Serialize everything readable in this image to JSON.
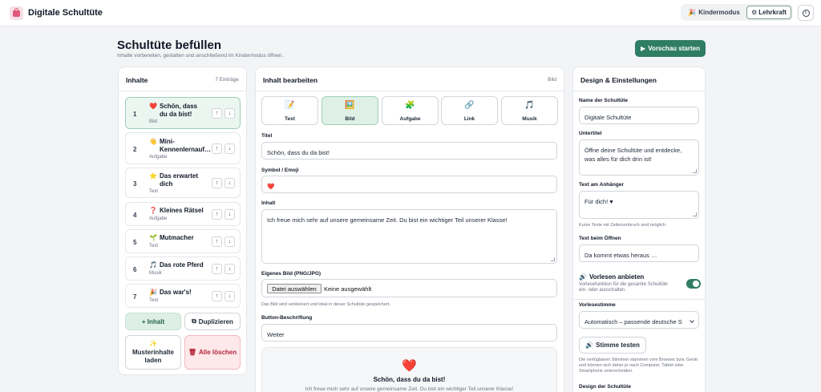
{
  "app": {
    "title": "Digitale Schultüte"
  },
  "header": {
    "kids_mode": "Kindermodus",
    "kids_icon": "🎉",
    "teacher_mode": "Lehrkraft",
    "teacher_icon": "⚙",
    "info_icon": "i"
  },
  "page": {
    "title": "Schultüte befüllen",
    "subtitle": "Inhalte vorbereiten, gestalten und anschließend im Kindermodus öffnen.",
    "preview_button": "Vorschau starten",
    "preview_icon": "▶"
  },
  "contents": {
    "title": "Inhalte",
    "count": "7 Einträge",
    "items": [
      {
        "num": "1",
        "emoji": "❤️",
        "title": "Schön, dass du da bist!",
        "type": "Bild"
      },
      {
        "num": "2",
        "emoji": "👋",
        "title": "Mini-Kennenlernauf…",
        "type": "Aufgabe"
      },
      {
        "num": "3",
        "emoji": "⭐",
        "title": "Das erwartet dich",
        "type": "Text"
      },
      {
        "num": "4",
        "emoji": "❓",
        "title": "Kleines Rätsel",
        "type": "Aufgabe"
      },
      {
        "num": "5",
        "emoji": "🌱",
        "title": "Mutmacher",
        "type": "Text"
      },
      {
        "num": "6",
        "emoji": "🎵",
        "title": "Das rote Pferd",
        "type": "Musik"
      },
      {
        "num": "7",
        "emoji": "🎉",
        "title": "Das war's!",
        "type": "Text"
      }
    ],
    "arrow_up": "↑",
    "arrow_down": "↓",
    "add_button": "+ Inhalt",
    "duplicate_button": "Duplizieren",
    "duplicate_icon": "⧉",
    "sample_button": "Musterinhalte laden",
    "sample_icon": "✨",
    "delete_button": "Alle löschen",
    "delete_icon": "🗑"
  },
  "editor": {
    "title": "Inhalt bearbeiten",
    "meta": "Bild",
    "types": [
      {
        "icon": "📝",
        "label": "Text"
      },
      {
        "icon": "🖼️",
        "label": "Bild"
      },
      {
        "icon": "🧩",
        "label": "Aufgabe"
      },
      {
        "icon": "🔗",
        "label": "Link"
      },
      {
        "icon": "🎵",
        "label": "Musik"
      }
    ],
    "title_label": "Titel",
    "title_value": "Schön, dass du da bist!",
    "symbol_label": "Symbol / Emoji",
    "symbol_value": "❤️",
    "content_label": "Inhalt",
    "content_value": "Ich freue mich sehr auf unsere gemeinsame Zeit. Du bist ein wichtiger Teil unserer Klasse!",
    "image_label": "Eigenes Bild (PNG/JPG)",
    "file_button": "Datei auswählen",
    "file_status": "Keine ausgewählt",
    "image_hint": "Das Bild wird verkleinert und lokal in dieser Schultüte gespeichert.",
    "button_label": "Button-Beschriftung",
    "button_value": "Weiter",
    "preview": {
      "emoji": "❤️",
      "title": "Schön, dass du da bist!",
      "text": "Ich freue mich sehr auf unsere gemeinsame Zeit. Du bist ein wichtiger Teil unserer Klasse!"
    }
  },
  "design": {
    "title": "Design & Einstellungen",
    "name_label": "Name der Schultüte",
    "name_value": "Digitale Schultüte",
    "subtitle_label": "Untertitel",
    "subtitle_value": "Öffne deine Schultüte und entdecke, was alles für dich drin ist!",
    "tag_label": "Text am Anhänger",
    "tag_value": "Für dich! ♥",
    "tag_hint": "Kurze Texte mit Zeilenumbruch sind möglich.",
    "open_label": "Text beim Öffnen",
    "open_value": "Da kommt etwas heraus …",
    "read_title": "Vorlesen anbieten",
    "read_icon": "🔊",
    "read_desc": "Vorlesefunktion für die gesamte Schultüte ein- oder ausschalten.",
    "read_enabled": true,
    "voice_label": "Vorlesestimme",
    "voice_value": "Automatisch – passende deutsche S",
    "test_button": "Stimme testen",
    "test_icon": "🔊",
    "voice_hint": "Die verfügbaren Stimmen stammen vom Browser bzw. Gerät und können sich daher je nach Computer, Tablet oder Smartphone unterscheiden.",
    "design_label": "Design der Schultüte"
  },
  "colors": {
    "accent": "#2f7d64",
    "accent_light": "#ddefe6",
    "danger": "#b4233a"
  }
}
